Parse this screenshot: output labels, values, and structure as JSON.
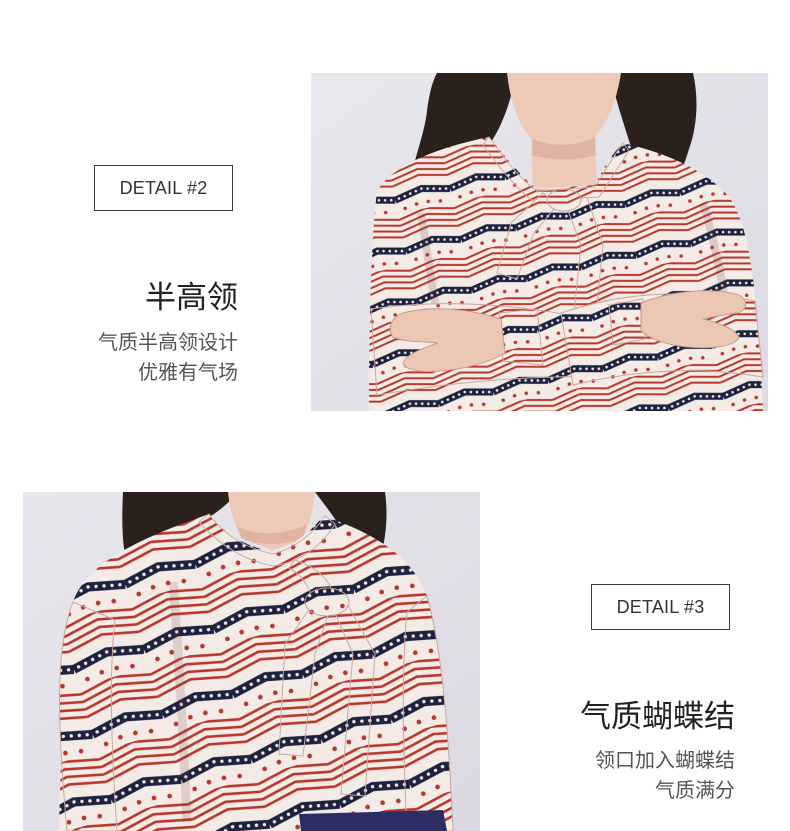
{
  "sections": [
    {
      "badge": "DETAIL #2",
      "title": "半高领",
      "lines": [
        "气质半高领设计",
        "优雅有气场"
      ]
    },
    {
      "badge": "DETAIL #3",
      "title": "气质蝴蝶结",
      "lines": [
        "领口加入蝴蝶结",
        "气质满分"
      ]
    }
  ],
  "colors": {
    "page_background": "#ffffff",
    "badge_border": "#3a3a3a",
    "badge_text": "#333333",
    "title_text": "#222222",
    "body_text": "#555555",
    "print_red": "#b7372c",
    "print_navy": "#1d2240",
    "print_base": "#f4ebe7"
  }
}
